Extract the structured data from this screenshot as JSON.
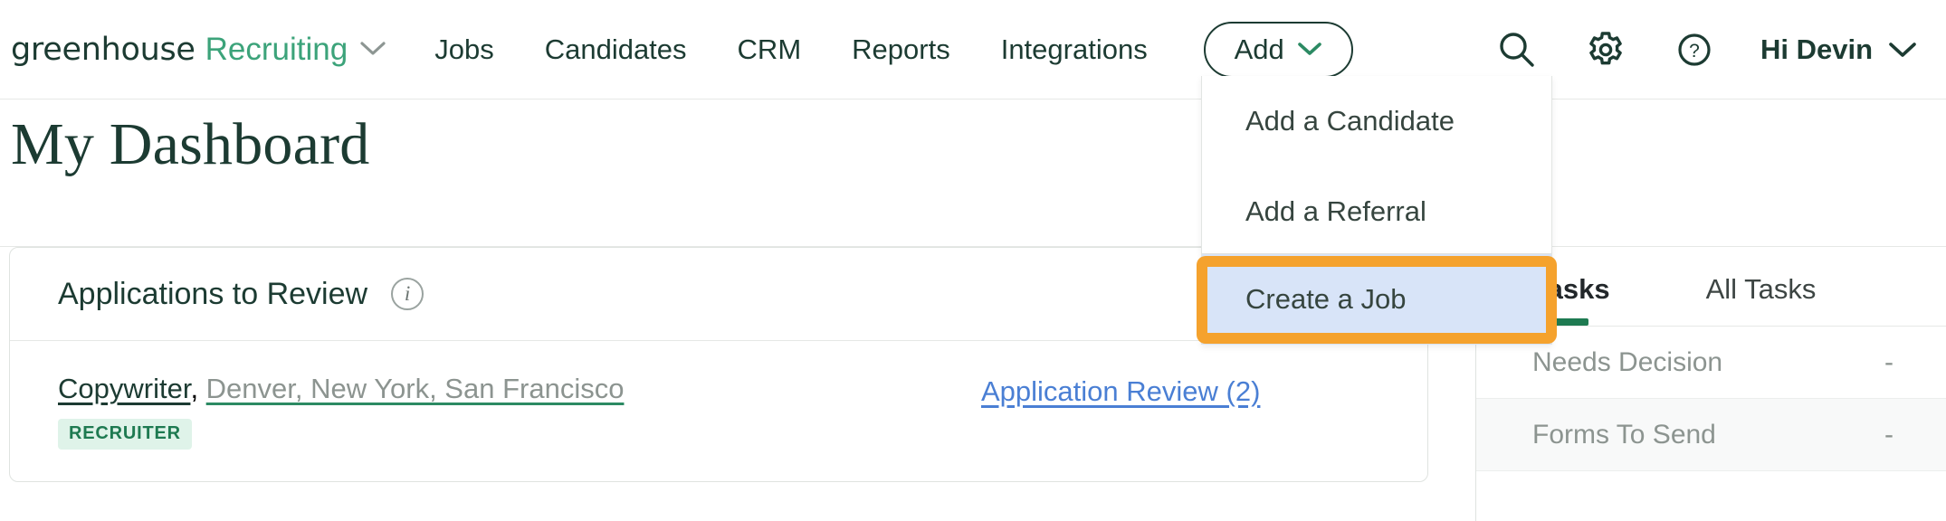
{
  "nav": {
    "brand_primary": "greenhouse",
    "brand_secondary": "Recruiting",
    "brand_caret_icon": "chevron-down-icon",
    "links": [
      {
        "label": "Jobs"
      },
      {
        "label": "Candidates"
      },
      {
        "label": "CRM"
      },
      {
        "label": "Reports"
      },
      {
        "label": "Integrations"
      }
    ],
    "add_button": {
      "label": "Add",
      "caret_icon": "chevron-down-icon"
    },
    "icons": [
      {
        "name": "search-icon"
      },
      {
        "name": "gear-icon"
      },
      {
        "name": "help-circle-icon"
      }
    ],
    "greeting": "Hi Devin",
    "greeting_caret_icon": "chevron-down-icon"
  },
  "add_menu": {
    "items": [
      {
        "label": "Add a Candidate",
        "selected": false
      },
      {
        "label": "Add a Referral",
        "selected": false
      },
      {
        "label": "Create a Job",
        "selected": true
      }
    ],
    "highlight_color": "#f5a22d",
    "selected_bg": "#d8e4f8"
  },
  "page": {
    "title": "My Dashboard"
  },
  "applications_card": {
    "title": "Applications to Review",
    "info_icon": "info-circle-icon",
    "info_glyph": "i",
    "rows": [
      {
        "job": "Copywriter",
        "separator": ", ",
        "locations": "Denver, New York, San Francisco",
        "badge": "RECRUITER",
        "link": "Application Review (2)"
      }
    ]
  },
  "tasks_panel": {
    "tabs": [
      {
        "label": "Tasks",
        "active": true
      },
      {
        "label": "All Tasks",
        "active": false
      }
    ],
    "rows": [
      {
        "label": "Needs Decision",
        "value": "-"
      },
      {
        "label": "Forms To Send",
        "value": "-"
      }
    ]
  },
  "colors": {
    "brand_green": "#3ca37a",
    "dark_green": "#1c3b32",
    "link_blue": "#4a7fd4",
    "badge_bg": "#dff3e9",
    "badge_text": "#1e7a51",
    "accent_underline": "#1e7a51"
  }
}
